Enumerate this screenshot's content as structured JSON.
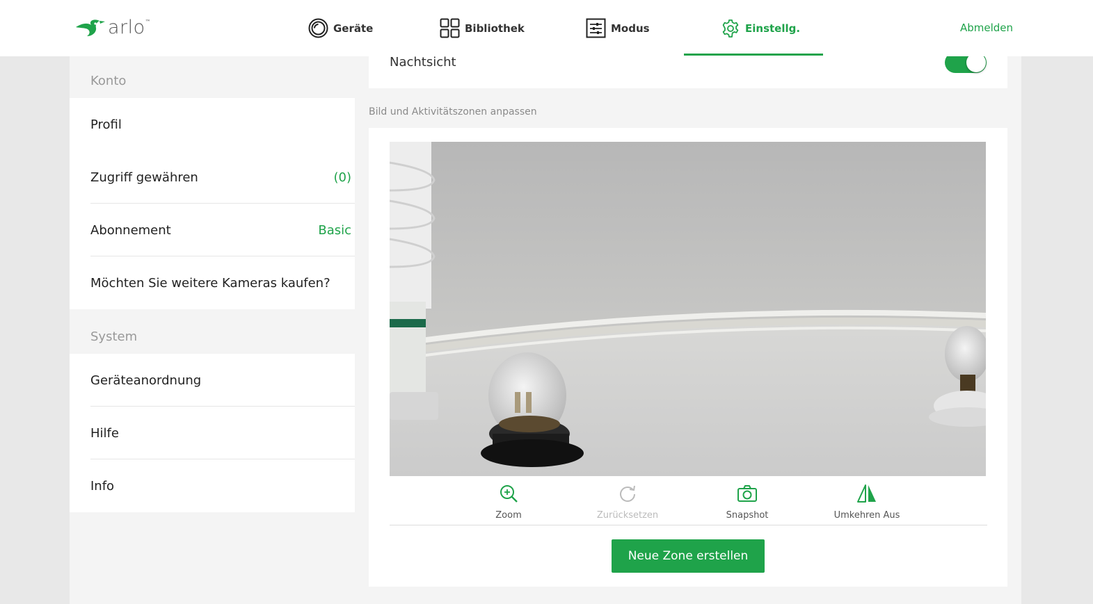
{
  "app": {
    "logo_text": "arlo",
    "logo_tm": "™"
  },
  "nav": {
    "items": [
      {
        "label": "Geräte",
        "icon": "devices-icon"
      },
      {
        "label": "Bibliothek",
        "icon": "library-grid-icon"
      },
      {
        "label": "Modus",
        "icon": "mode-sliders-icon"
      },
      {
        "label": "Einstellg.",
        "icon": "settings-gear-icon",
        "active": true
      }
    ],
    "logout": "Abmelden",
    "accent_color": "#1fa34a"
  },
  "sidebar": {
    "account_label": "Konto",
    "account_items": [
      {
        "label": "Profil",
        "value": ""
      },
      {
        "label": "Zugriff gewähren",
        "value": "(0)"
      },
      {
        "label": "Abonnement",
        "value": "Basic"
      },
      {
        "label": "Möchten Sie weitere Kameras kaufen?",
        "value": ""
      }
    ],
    "system_label": "System",
    "system_items": [
      {
        "label": "Geräteanordnung"
      },
      {
        "label": "Hilfe"
      },
      {
        "label": "Info"
      }
    ]
  },
  "settings": {
    "night_vision_label": "Nachtsicht",
    "night_vision_on": true,
    "image_section_label": "Bild und Aktivitätszonen anpassen"
  },
  "camera_tools": [
    {
      "label": "Zoom",
      "icon": "zoom-in-icon",
      "enabled": true
    },
    {
      "label": "Zurücksetzen",
      "icon": "reset-icon",
      "enabled": false
    },
    {
      "label": "Snapshot",
      "icon": "camera-icon",
      "enabled": true
    },
    {
      "label": "Umkehren Aus",
      "icon": "flip-icon",
      "enabled": true
    }
  ],
  "create_zone_button": "Neue Zone erstellen"
}
